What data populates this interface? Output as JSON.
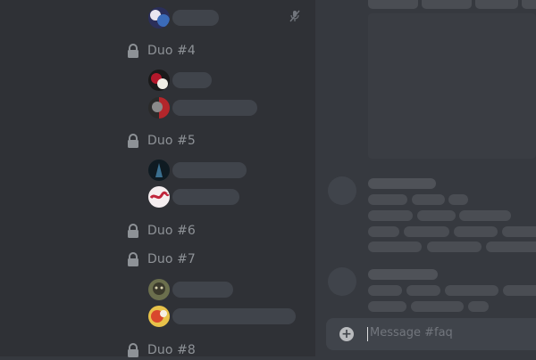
{
  "sidebar": {
    "channels": [
      {
        "label": "Duo #4"
      },
      {
        "label": "Duo #5"
      },
      {
        "label": "Duo #6"
      },
      {
        "label": "Duo #7"
      },
      {
        "label": "Duo #8"
      }
    ],
    "icons": {
      "lock": "lock-icon",
      "mute": "microphone-muted-icon"
    }
  },
  "composer": {
    "placeholder": "Message #faq",
    "add_icon": "plus-circle-icon"
  },
  "colors": {
    "sidebar_bg": "#2f3136",
    "main_bg": "#36393f",
    "skeleton": "#4a4d53",
    "channel_text": "#8e9297"
  }
}
